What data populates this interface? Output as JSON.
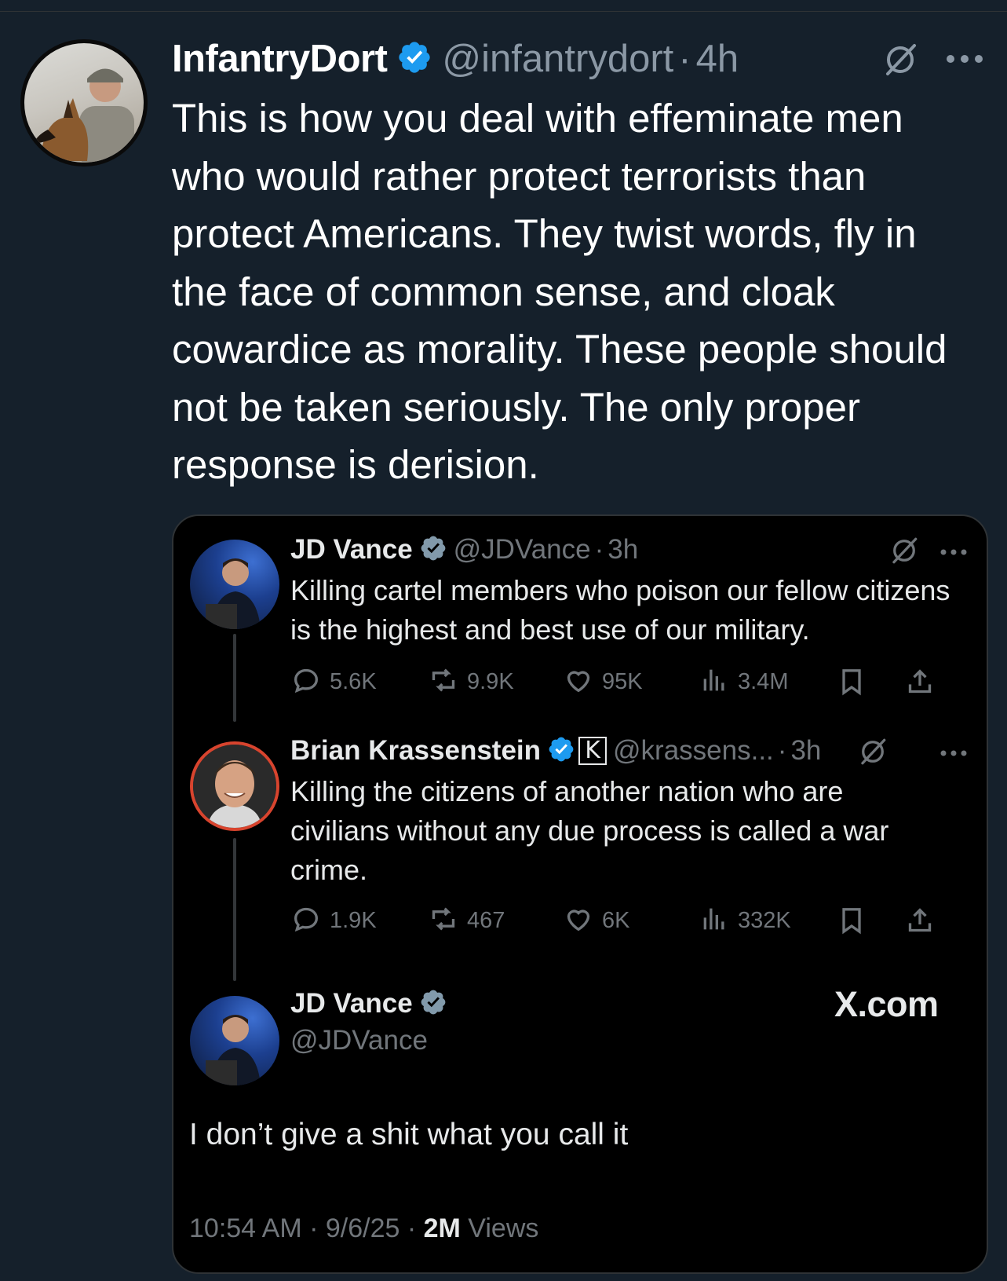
{
  "outer_tweet": {
    "display_name": "InfantryDort",
    "handle": "@infantrydort",
    "separator": "·",
    "time": "4h",
    "text": "This is how you deal with effeminate men who would rather protect terrorists than protect Americans. They twist words, fly in the face of common sense, and cloak cowardice as morality. These people should not be taken seriously. The only proper response is derision.",
    "more_icon": "more-horizontal-icon",
    "grok_icon": "grok-icon"
  },
  "quote": {
    "tweet1": {
      "display_name": "JD Vance",
      "handle": "@JDVance",
      "separator": "·",
      "time": "3h",
      "text": "Killing cartel members who poison our fellow citizens is the highest and best use of our military.",
      "replies": "5.6K",
      "reposts": "9.9K",
      "likes": "95K",
      "views": "3.4M"
    },
    "tweet2": {
      "display_name": "Brian Krassenstein",
      "handle": "@krassens...",
      "separator": "·",
      "time": "3h",
      "affiliate_badge": "K",
      "text": "Killing the citizens of another nation who are civilians without any due process is called a war crime.",
      "replies": "1.9K",
      "reposts": "467",
      "likes": "6K",
      "views": "332K"
    },
    "tweet3": {
      "display_name": "JD Vance",
      "handle": "@JDVance",
      "site": "X.com",
      "text": "I don’t give a shit what you call it",
      "time_date": "10:54 AM · 9/6/25 · ",
      "views_count": "2M",
      "views_label": " Views"
    }
  },
  "colors": {
    "background": "#15202b",
    "card_background": "#000000",
    "verified_blue": "#1d9bf0",
    "secondary_text": "#71767b"
  }
}
